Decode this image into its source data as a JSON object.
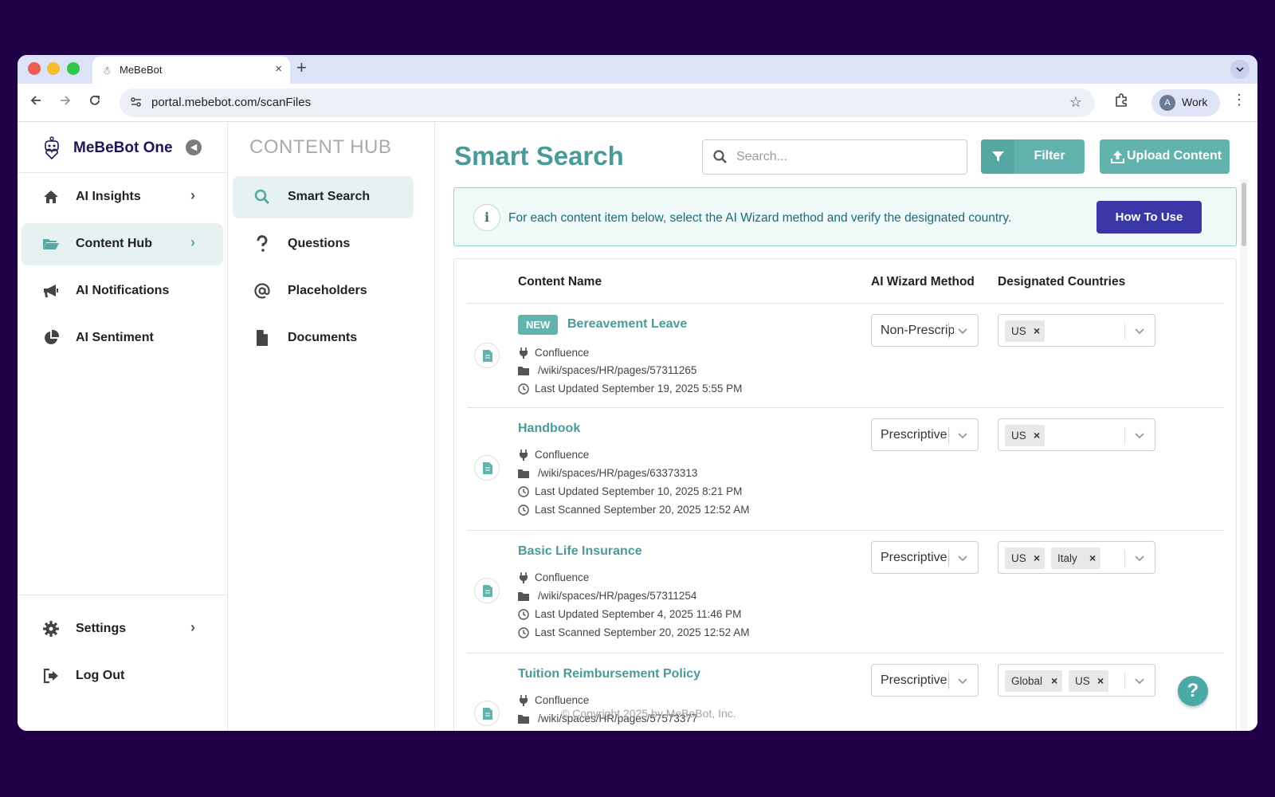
{
  "browser": {
    "tab_title": "MeBeBot",
    "tab_close": "×",
    "new_tab": "+",
    "url": "portal.mebebot.com/scanFiles",
    "profile_initial": "A",
    "profile_label": "Work"
  },
  "sidebar": {
    "brand": "MeBeBot One",
    "items": [
      {
        "label": "AI Insights",
        "icon": "home-icon",
        "chevron": true,
        "active": false
      },
      {
        "label": "Content Hub",
        "icon": "folder-open-icon",
        "chevron": true,
        "active": true
      },
      {
        "label": "AI Notifications",
        "icon": "megaphone-icon",
        "chevron": false,
        "active": false
      },
      {
        "label": "AI Sentiment",
        "icon": "pie-chart-icon",
        "chevron": false,
        "active": false
      }
    ],
    "bottom_items": [
      {
        "label": "Settings",
        "icon": "gear-icon",
        "chevron": true
      },
      {
        "label": "Log Out",
        "icon": "logout-icon",
        "chevron": false
      }
    ]
  },
  "hub": {
    "title": "CONTENT HUB",
    "items": [
      {
        "label": "Smart Search",
        "icon": "search-icon",
        "active": true
      },
      {
        "label": "Questions",
        "icon": "question-icon",
        "active": false
      },
      {
        "label": "Placeholders",
        "icon": "at-icon",
        "active": false
      },
      {
        "label": "Documents",
        "icon": "file-icon",
        "active": false
      }
    ]
  },
  "main": {
    "title": "Smart Search",
    "search_placeholder": "Search...",
    "filter_label": "Filter",
    "upload_label": "Upload Content",
    "info_text": "For each content item below, select the AI Wizard method and verify the designated country.",
    "how_to_label": "How To Use",
    "columns": {
      "name": "Content Name",
      "method": "AI Wizard Method",
      "countries": "Designated Countries"
    },
    "rows": [
      {
        "badge": "NEW",
        "name": "Bereavement Leave",
        "source": "Confluence",
        "path": "/wiki/spaces/HR/pages/57311265",
        "updated": "Last Updated September 19, 2025 5:55 PM",
        "scanned": "",
        "method": "Non-Prescriptive",
        "countries": [
          "US"
        ]
      },
      {
        "badge": "",
        "name": "Handbook",
        "source": "Confluence",
        "path": "/wiki/spaces/HR/pages/63373313",
        "updated": "Last Updated September 10, 2025 8:21 PM",
        "scanned": "Last Scanned September 20, 2025 12:52 AM",
        "method": "Prescriptive",
        "countries": [
          "US"
        ]
      },
      {
        "badge": "",
        "name": "Basic Life Insurance",
        "source": "Confluence",
        "path": "/wiki/spaces/HR/pages/57311254",
        "updated": "Last Updated September 4, 2025 11:46 PM",
        "scanned": "Last Scanned September 20, 2025 12:52 AM",
        "method": "Prescriptive",
        "countries": [
          "US",
          "Italy"
        ]
      },
      {
        "badge": "",
        "name": "Tuition Reimbursement Policy",
        "source": "Confluence",
        "path": "/wiki/spaces/HR/pages/57573377",
        "updated": "",
        "scanned": "",
        "method": "Prescriptive",
        "countries": [
          "Global",
          "US"
        ]
      }
    ],
    "footer": "© Copyright 2025 by MeBeBot, Inc.",
    "help": "?"
  },
  "colors": {
    "accent": "#4a9b98",
    "button": "#62b3ad",
    "primary": "#3a37a6",
    "brand": "#1d1556",
    "desktop": "#1f0048"
  }
}
